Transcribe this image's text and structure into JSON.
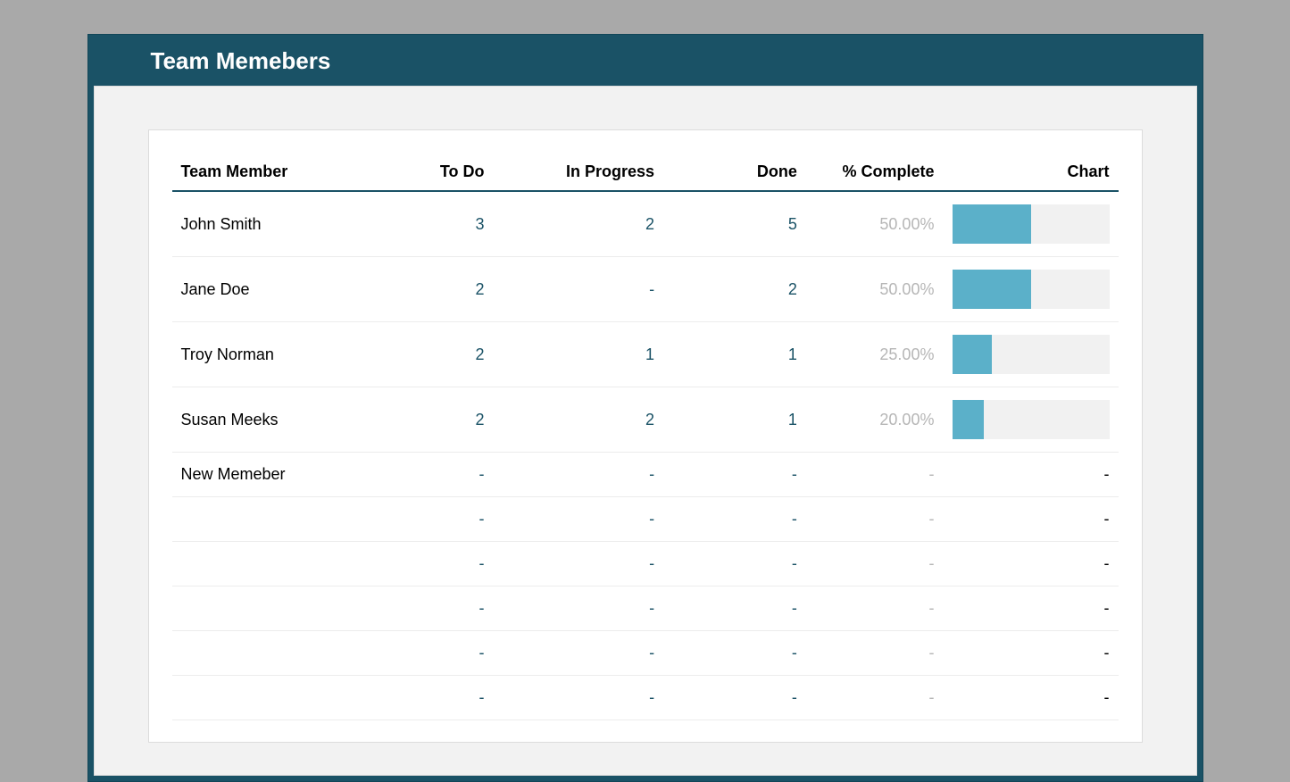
{
  "page_title": "Team Memebers",
  "columns": {
    "member": "Team Member",
    "todo": "To Do",
    "in_progress": "In Progress",
    "done": "Done",
    "pct": "% Complete",
    "chart": "Chart"
  },
  "dash": "-",
  "rows": [
    {
      "name": "John Smith",
      "todo": "3",
      "in_progress": "2",
      "done": "5",
      "pct": "50.00%",
      "chart_pct": 50
    },
    {
      "name": "Jane Doe",
      "todo": "2",
      "in_progress": "-",
      "done": "2",
      "pct": "50.00%",
      "chart_pct": 50
    },
    {
      "name": "Troy Norman",
      "todo": "2",
      "in_progress": "1",
      "done": "1",
      "pct": "25.00%",
      "chart_pct": 25
    },
    {
      "name": "Susan Meeks",
      "todo": "2",
      "in_progress": "2",
      "done": "1",
      "pct": "20.00%",
      "chart_pct": 20
    },
    {
      "name": "New Memeber",
      "todo": "-",
      "in_progress": "-",
      "done": "-",
      "pct": "-",
      "chart_pct": null
    },
    {
      "name": "",
      "todo": "-",
      "in_progress": "-",
      "done": "-",
      "pct": "-",
      "chart_pct": null
    },
    {
      "name": "",
      "todo": "-",
      "in_progress": "-",
      "done": "-",
      "pct": "-",
      "chart_pct": null
    },
    {
      "name": "",
      "todo": "-",
      "in_progress": "-",
      "done": "-",
      "pct": "-",
      "chart_pct": null
    },
    {
      "name": "",
      "todo": "-",
      "in_progress": "-",
      "done": "-",
      "pct": "-",
      "chart_pct": null
    },
    {
      "name": "",
      "todo": "-",
      "in_progress": "-",
      "done": "-",
      "pct": "-",
      "chart_pct": null
    }
  ],
  "chart_data": {
    "type": "bar",
    "title": "Chart",
    "xlabel": "",
    "ylabel": "% Complete",
    "ylim": [
      0,
      100
    ],
    "categories": [
      "John Smith",
      "Jane Doe",
      "Troy Norman",
      "Susan Meeks"
    ],
    "values": [
      50,
      50,
      25,
      20
    ]
  }
}
